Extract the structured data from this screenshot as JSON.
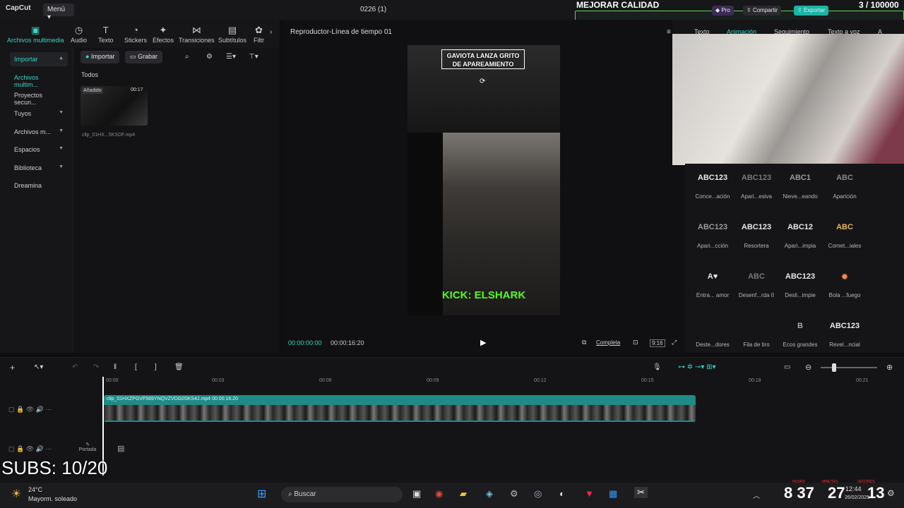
{
  "app": {
    "logo": "CapCut",
    "menu": "Menú",
    "project_title": "0226 (1)"
  },
  "overlay": {
    "quality": "MEJORAR CALIDAD",
    "counter": "3 / 100000",
    "subs": "SUBS: 10/20"
  },
  "top_buttons": {
    "pro": "Pro",
    "share": "Compartir",
    "export": "Exportar"
  },
  "media_tabs": [
    {
      "label": "Archivos multimedia",
      "icon": "media-icon"
    },
    {
      "label": "Audio",
      "icon": "audio-icon"
    },
    {
      "label": "Texto",
      "icon": "text-icon"
    },
    {
      "label": "Stickers",
      "icon": "sticker-icon"
    },
    {
      "label": "Efectos",
      "icon": "effects-icon"
    },
    {
      "label": "Transiciones",
      "icon": "transitions-icon"
    },
    {
      "label": "Subtítulos",
      "icon": "subtitles-icon"
    },
    {
      "label": "Filtr",
      "icon": "filters-icon"
    }
  ],
  "sidebar": [
    {
      "label": "Importar"
    },
    {
      "label": "Archivos multim..."
    },
    {
      "label": "Proyectos secun..."
    },
    {
      "label": "Tuyos"
    },
    {
      "label": "Archivos m..."
    },
    {
      "label": "Espacios"
    },
    {
      "label": "Biblioteca"
    },
    {
      "label": "Dreamina"
    }
  ],
  "media": {
    "import": "Importar",
    "record": "Grabar",
    "all": "Todos",
    "badge": "Añadido",
    "duration": "00:17",
    "filename": "clip_01HX...5KSDF.mp4"
  },
  "player": {
    "title": "Reproductor-Línea de tiempo 01",
    "caption": "GAVIOTA LANZA GRITO DE APAREAMIENTO",
    "kick": "KICK: ELSHARK",
    "time_current": "00:00:00:00",
    "time_total": "00:00:16:20",
    "full": "Completa",
    "ratio": "9:16"
  },
  "right_tabs": [
    {
      "label": "Texto"
    },
    {
      "label": "Animación"
    },
    {
      "label": "Seguimiento"
    },
    {
      "label": "Texto a voz"
    },
    {
      "label": "A"
    }
  ],
  "effects": [
    {
      "preview": "ABC123",
      "label": "Conce...ación"
    },
    {
      "preview": "ABC123",
      "label": "Apari...esiva"
    },
    {
      "preview": "ABC1",
      "label": "Nieve...eando"
    },
    {
      "preview": "ABC",
      "label": "Aparición"
    },
    {
      "preview": "ABC123",
      "label": "Apari...cción"
    },
    {
      "preview": "ABC123",
      "label": "Resortera"
    },
    {
      "preview": "ABC12",
      "label": "Apari...impia"
    },
    {
      "preview": "ABC",
      "label": "Comet...iales"
    },
    {
      "preview": "A♥",
      "label": "Entra... amor"
    },
    {
      "preview": "ABC",
      "label": "Desenf...rda II"
    },
    {
      "preview": "ABC123",
      "label": "Desli...impie"
    },
    {
      "preview": "✹",
      "label": "Bola ...fuego"
    },
    {
      "preview": "",
      "label": "Deste...dores"
    },
    {
      "preview": "",
      "label": "Fila de tiro"
    },
    {
      "preview": "B",
      "label": "Ecos grandes"
    },
    {
      "preview": "ABC123",
      "label": "Revel...ncial"
    }
  ],
  "timeline": {
    "ticks": [
      "00:00",
      "00:03",
      "00:06",
      "00:09",
      "00:12",
      "00:15",
      "00:18",
      "00:21"
    ],
    "clip_label": "clip_01HXZPGVF569YNQVZVDG0SKS4J.mp4  00:00:16:20",
    "cover": "Portada"
  },
  "taskbar": {
    "temp": "24°C",
    "weather": "Mayorm. soleado",
    "search": "Buscar",
    "time": "12:44",
    "date": "26/02/2025",
    "hours": "8",
    "minutes": "37",
    "sec_a": "27",
    "sec_b": "13",
    "lbl_h": "HOURS",
    "lbl_m": "MINUTES",
    "lbl_s": "SECONDS"
  }
}
